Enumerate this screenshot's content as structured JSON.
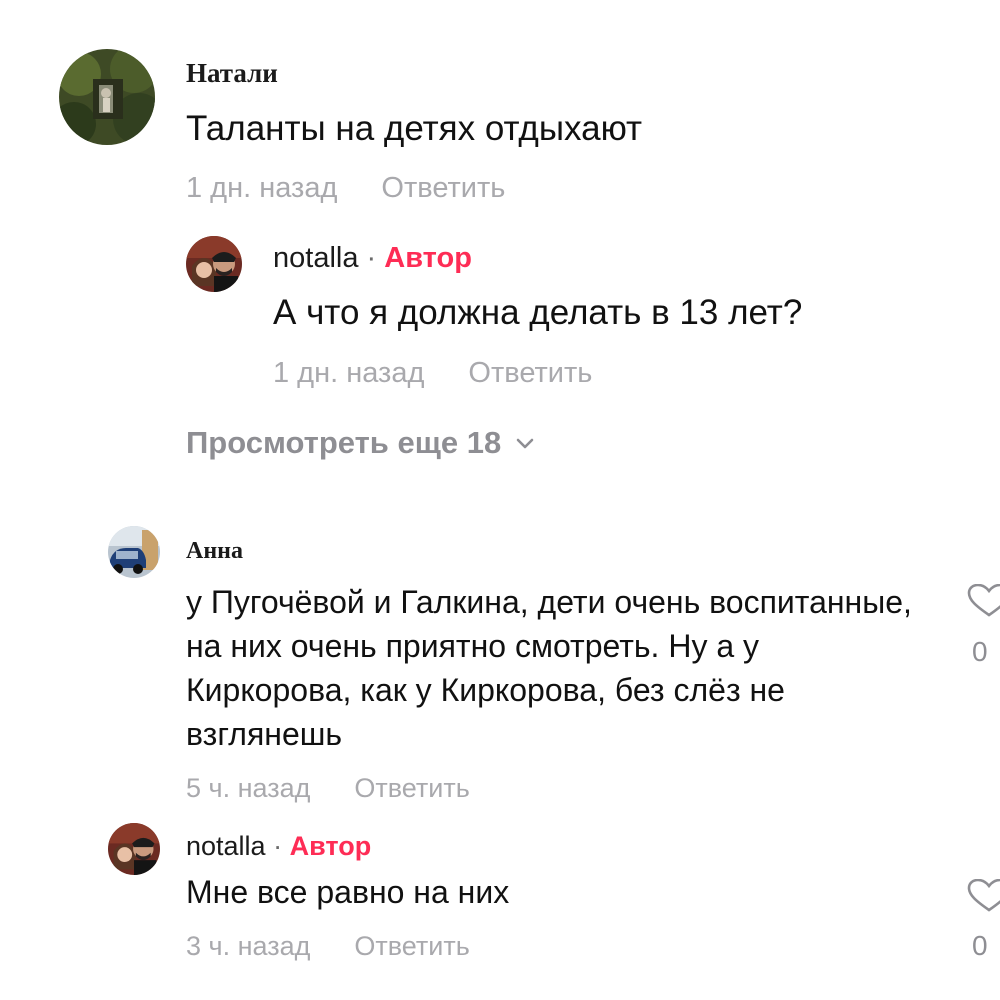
{
  "comments": [
    {
      "author": "Натали",
      "text": "Таланты на детях отдыхают",
      "time": "1 дн. назад",
      "reply_label": "Ответить",
      "avatar_icon": "garden-photo-avatar",
      "replies": [
        {
          "author": "notalla",
          "separator": "·",
          "badge": "Автор",
          "text": "А что я должна делать в 13 лет?",
          "time": "1 дн. назад",
          "reply_label": "Ответить",
          "avatar_icon": "couple-photo-avatar"
        }
      ],
      "view_more": "Просмотреть еще 18"
    },
    {
      "author": "Анна",
      "text": "у Пугочёвой и Галкина, дети очень воспитанные, на них очень приятно смотреть. Ну а у Киркорова, как у Киркорова, без слёз не взглянешь",
      "time": "5 ч. назад",
      "reply_label": "Ответить",
      "avatar_icon": "car-photo-avatar",
      "like_count": "0"
    },
    {
      "author": "notalla",
      "separator": "·",
      "badge": "Автор",
      "text": "Мне все равно на них",
      "time": "3 ч. назад",
      "reply_label": "Ответить",
      "avatar_icon": "couple-photo-avatar",
      "like_count": "0"
    }
  ],
  "colors": {
    "author_badge": "#fe2c55",
    "meta_text": "#a9a9ad",
    "view_more": "#8e8e93"
  },
  "icons": {
    "chevron": "chevron-down-icon",
    "like": "heart-icon"
  }
}
